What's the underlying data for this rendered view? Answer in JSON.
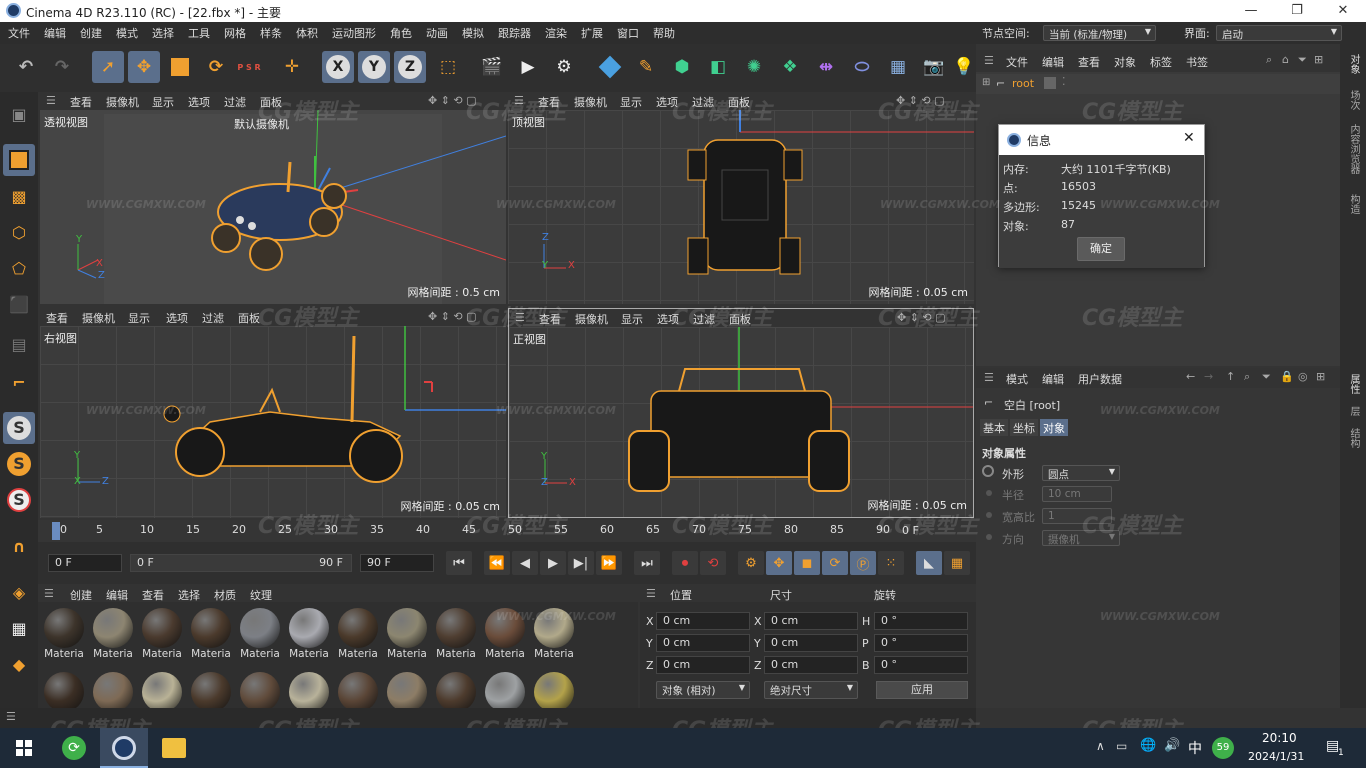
{
  "app": {
    "title": "Cinema 4D R23.110 (RC) - [22.fbx *] - 主要",
    "window_controls": [
      "—",
      "❐",
      "✕"
    ]
  },
  "menu": {
    "items": [
      "文件",
      "编辑",
      "创建",
      "模式",
      "选择",
      "工具",
      "网格",
      "样条",
      "体积",
      "运动图形",
      "角色",
      "动画",
      "模拟",
      "跟踪器",
      "渲染",
      "扩展",
      "窗口",
      "帮助"
    ],
    "node_space_label": "节点空间:",
    "node_space_value": "当前 (标准/物理)",
    "layout_label": "界面:",
    "layout_value": "启动"
  },
  "toolbar": {
    "axis_x": "X",
    "axis_y": "Y",
    "axis_z": "Z",
    "psr": "P S R"
  },
  "viewport_menu": [
    "查看",
    "摄像机",
    "显示",
    "选项",
    "过滤",
    "面板"
  ],
  "viewports": [
    {
      "label": "透视视图",
      "camera": "默认摄像机",
      "grid": "网格间距 : 0.5 cm"
    },
    {
      "label": "顶视图",
      "camera": "",
      "grid": "网格间距 : 0.05 cm"
    },
    {
      "label": "右视图",
      "camera": "",
      "grid": "网格间距 : 0.05 cm"
    },
    {
      "label": "正视图",
      "camera": "",
      "grid": "网格间距 : 0.05 cm"
    }
  ],
  "axis_letters": {
    "x": "X",
    "y": "Y",
    "z": "Z"
  },
  "watermark": {
    "logo": "CG模型主",
    "url": "WWW.CGMXW.COM"
  },
  "timeline": {
    "ticks": [
      "0",
      "5",
      "10",
      "15",
      "20",
      "25",
      "30",
      "35",
      "40",
      "45",
      "50",
      "55",
      "60",
      "65",
      "70",
      "75",
      "80",
      "85",
      "90"
    ],
    "end_label": "0 F",
    "start_field": "0 F",
    "range_start": "0 F",
    "range_end": "90 F",
    "end_field": "90 F"
  },
  "material_panel": {
    "menu": [
      "创建",
      "编辑",
      "查看",
      "选择",
      "材质",
      "纹理"
    ],
    "label": "Materia",
    "row1_colors": [
      "#3d342b",
      "#8d8571",
      "#4a3a2e",
      "#4b3a2c",
      "#7c7f85",
      "#a9aab0",
      "#4b3a2b",
      "#8c8670",
      "#4f3e31",
      "#6a4c3a",
      "#b1a98a"
    ],
    "row2_colors": [
      "#3b2e24",
      "#7e6a55",
      "#b9b296",
      "#4b3a2c",
      "#604b3b",
      "#b8b29a",
      "#5a4536",
      "#8d7d66",
      "#4d3b2d",
      "#9ea1a3",
      "#b3a24a"
    ]
  },
  "coords": {
    "headers": [
      "位置",
      "尺寸",
      "旋转"
    ],
    "rows": [
      {
        "axis": "X",
        "pos": "0 cm",
        "saxis": "X",
        "size": "0 cm",
        "raxis": "H",
        "rot": "0 °"
      },
      {
        "axis": "Y",
        "pos": "0 cm",
        "saxis": "Y",
        "size": "0 cm",
        "raxis": "P",
        "rot": "0 °"
      },
      {
        "axis": "Z",
        "pos": "0 cm",
        "saxis": "Z",
        "size": "0 cm",
        "raxis": "B",
        "rot": "0 °"
      }
    ],
    "mode": "对象 (相对)",
    "size_mode": "绝对尺寸",
    "apply": "应用"
  },
  "object_manager": {
    "menu": [
      "文件",
      "编辑",
      "查看",
      "对象",
      "标签",
      "书签"
    ],
    "root": "root"
  },
  "info_dialog": {
    "title": "信息",
    "rows": [
      {
        "label": "内存:",
        "value": "大约 1101千字节(KB)"
      },
      {
        "label": "点:",
        "value": "16503"
      },
      {
        "label": "多边形:",
        "value": "15245"
      },
      {
        "label": "对象:",
        "value": "87"
      }
    ],
    "ok": "确定"
  },
  "attribute_manager": {
    "menu": [
      "模式",
      "编辑",
      "用户数据"
    ],
    "object": "空白 [root]",
    "tabs": [
      "基本",
      "坐标",
      "对象"
    ],
    "section": "对象属性",
    "props": [
      {
        "label": "外形",
        "value": "圆点"
      },
      {
        "label": "半径",
        "value": "10 cm"
      },
      {
        "label": "宽高比",
        "value": "1"
      },
      {
        "label": "方向",
        "value": "摄像机"
      }
    ]
  },
  "side_tabs": [
    "对象",
    "场次",
    "内容浏览器",
    "构造",
    "属性",
    "层",
    "结构"
  ],
  "taskbar": {
    "ime": "中",
    "badge": "59",
    "time": "20:10",
    "date": "2024/1/31",
    "notif": "1"
  },
  "colors": {
    "accent_orange": "#f0a030",
    "selected_blue": "#5b6f8c",
    "axis_red": "#e04040",
    "axis_green": "#40c040",
    "axis_blue": "#4080e0"
  }
}
